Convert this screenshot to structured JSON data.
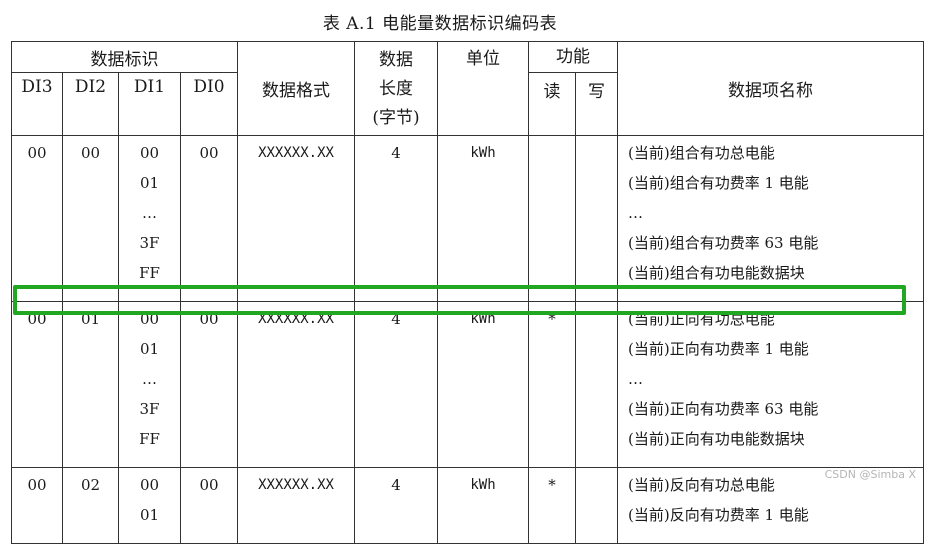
{
  "caption": "表 A.1   电能量数据标识编码表",
  "header": {
    "data_id": "数据标识",
    "di3": "DI3",
    "di2": "DI2",
    "di1": "DI1",
    "di0": "DI0",
    "format": "数据格式",
    "length_line1": "数据",
    "length_line2": "长度",
    "length_line3": "(字节)",
    "unit": "单位",
    "function": "功能",
    "read": "读",
    "write": "写",
    "name": "数据项名称"
  },
  "groups": [
    {
      "di3": "00",
      "di2": "00",
      "di1": [
        "00",
        "01",
        "…",
        "3F",
        "FF"
      ],
      "di0": "00",
      "format": "XXXXXX.XX",
      "length": "4",
      "unit": "kWh",
      "read": "",
      "write": "",
      "names": [
        "(当前)组合有功总电能",
        "(当前)组合有功费率 1 电能",
        "…",
        "(当前)组合有功费率 63 电能",
        "(当前)组合有功电能数据块"
      ]
    },
    {
      "di3": "00",
      "di2": "01",
      "di1": [
        "00",
        "01",
        "…",
        "3F",
        "FF"
      ],
      "di0": "00",
      "format": "XXXXXX.XX",
      "length": "4",
      "unit": "kWh",
      "read": "*",
      "write": "",
      "names": [
        "(当前)正向有功总电能",
        "(当前)正向有功费率 1 电能",
        "…",
        "(当前)正向有功费率 63 电能",
        "(当前)正向有功电能数据块"
      ]
    },
    {
      "di3": "00",
      "di2": "02",
      "di1": [
        "00",
        "01"
      ],
      "di0": "00",
      "format": "XXXXXX.XX",
      "length": "4",
      "unit": "kWh",
      "read": "*",
      "write": "",
      "names": [
        "(当前)反向有功总电能",
        "(当前)反向有功费率 1 电能"
      ]
    }
  ],
  "colors": {
    "highlight": "#22a722",
    "border": "#333333"
  },
  "watermark": "CSDN @Simba X"
}
